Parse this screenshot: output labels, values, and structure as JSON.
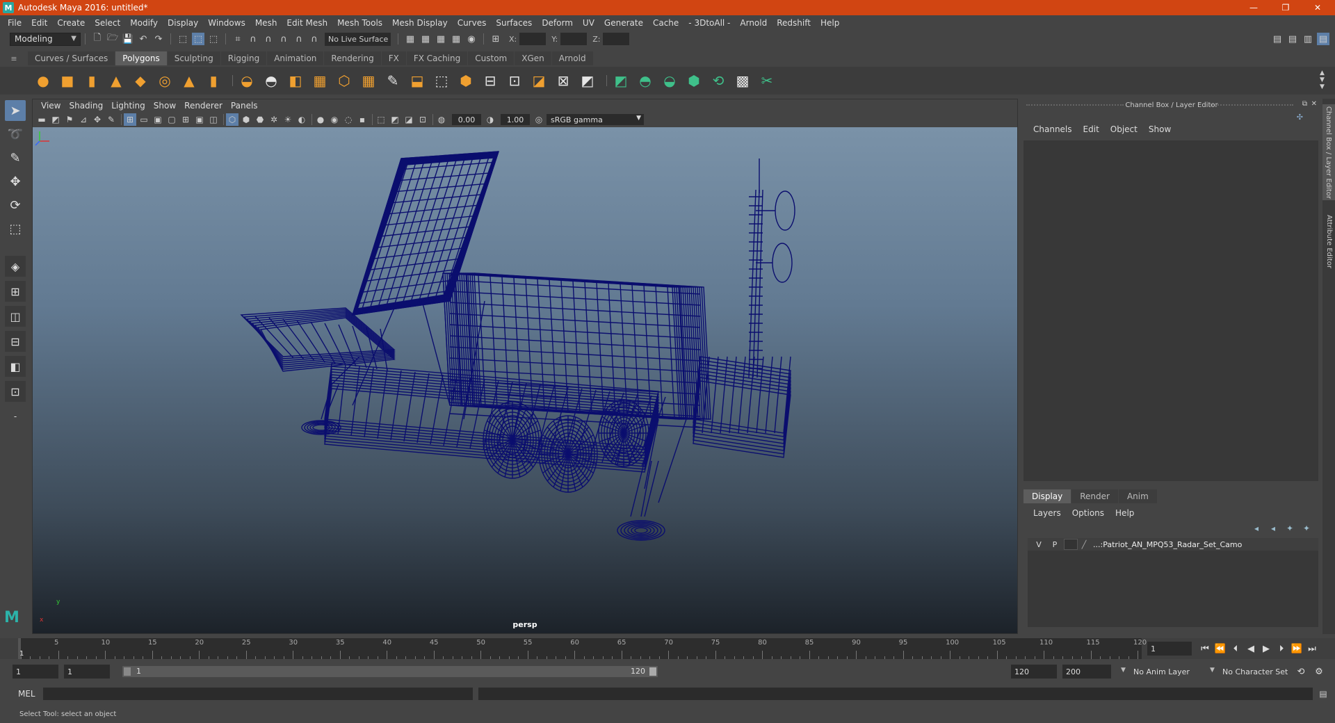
{
  "window": {
    "title": "Autodesk Maya 2016: untitled*",
    "app_icon": "M",
    "minimize": "—",
    "maximize": "❐",
    "close": "✕"
  },
  "menubar": [
    "File",
    "Edit",
    "Create",
    "Select",
    "Modify",
    "Display",
    "Windows",
    "Mesh",
    "Edit Mesh",
    "Mesh Tools",
    "Mesh Display",
    "Curves",
    "Surfaces",
    "Deform",
    "UV",
    "Generate",
    "Cache",
    "- 3DtoAll -",
    "Arnold",
    "Redshift",
    "Help"
  ],
  "statusline": {
    "mode": "Modeling",
    "live_surface": "No Live Surface",
    "x_label": "X:",
    "y_label": "Y:",
    "z_label": "Z:"
  },
  "shelf": {
    "tabs": [
      "Curves / Surfaces",
      "Polygons",
      "Sculpting",
      "Rigging",
      "Animation",
      "Rendering",
      "FX",
      "FX Caching",
      "Custom",
      "XGen",
      "Arnold"
    ],
    "active_tab": "Polygons"
  },
  "viewport": {
    "menus": [
      "View",
      "Shading",
      "Lighting",
      "Show",
      "Renderer",
      "Panels"
    ],
    "exposure": "0.00",
    "gamma": "1.00",
    "color_space": "sRGB gamma",
    "camera_label": "persp",
    "axis_x": "x",
    "axis_y": "y",
    "wire_color": "#0b0e6e"
  },
  "channelbox": {
    "header": "Channel Box / Layer Editor",
    "menus": [
      "Channels",
      "Edit",
      "Object",
      "Show"
    ],
    "layer_tabs": [
      "Display",
      "Render",
      "Anim"
    ],
    "layer_menus": [
      "Layers",
      "Options",
      "Help"
    ],
    "layer": {
      "visible": "V",
      "playback": "P",
      "name": "...:Patriot_AN_MPQ53_Radar_Set_Camo"
    }
  },
  "side_tabs": [
    "Channel Box / Layer Editor",
    "Attribute Editor"
  ],
  "timeline": {
    "ticks": [
      5,
      10,
      15,
      20,
      25,
      30,
      35,
      40,
      45,
      50,
      55,
      60,
      65,
      70,
      75,
      80,
      85,
      90,
      95,
      100,
      105,
      110,
      115,
      120
    ],
    "current_frame": "1",
    "current_frame_field": "1"
  },
  "range": {
    "start": "1",
    "playback_start": "1",
    "slider_start": "1",
    "slider_end": "120",
    "playback_end": "120",
    "end": "200",
    "anim_layer": "No Anim Layer",
    "character_set": "No Character Set"
  },
  "cmdline": {
    "label": "MEL"
  },
  "helpline": {
    "text": "Select Tool: select an object"
  }
}
